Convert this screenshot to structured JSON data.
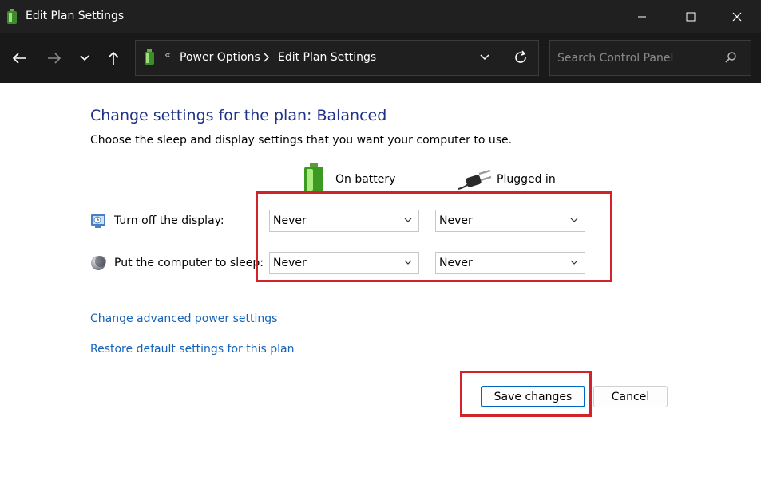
{
  "window": {
    "title": "Edit Plan Settings"
  },
  "nav": {
    "breadcrumb": [
      "Power Options",
      "Edit Plan Settings"
    ],
    "search_placeholder": "Search Control Panel"
  },
  "content": {
    "heading": "Change settings for the plan: Balanced",
    "description": "Choose the sleep and display settings that you want your computer to use.",
    "columns": {
      "battery": "On battery",
      "plugged": "Plugged in"
    },
    "rows": [
      {
        "label": "Turn off the display:",
        "battery_value": "Never",
        "plugged_value": "Never",
        "icon": "display-icon"
      },
      {
        "label": "Put the computer to sleep:",
        "battery_value": "Never",
        "plugged_value": "Never",
        "icon": "sleep-moon-icon"
      }
    ],
    "links": {
      "advanced": "Change advanced power settings",
      "restore": "Restore default settings for this plan"
    }
  },
  "buttons": {
    "save": "Save changes",
    "cancel": "Cancel"
  },
  "colors": {
    "title_bar": "#202020",
    "nav_bar": "#191919",
    "heading": "#1e3287",
    "link": "#1463b8",
    "highlight": "#d2232a",
    "primary_border": "#0067c0"
  }
}
